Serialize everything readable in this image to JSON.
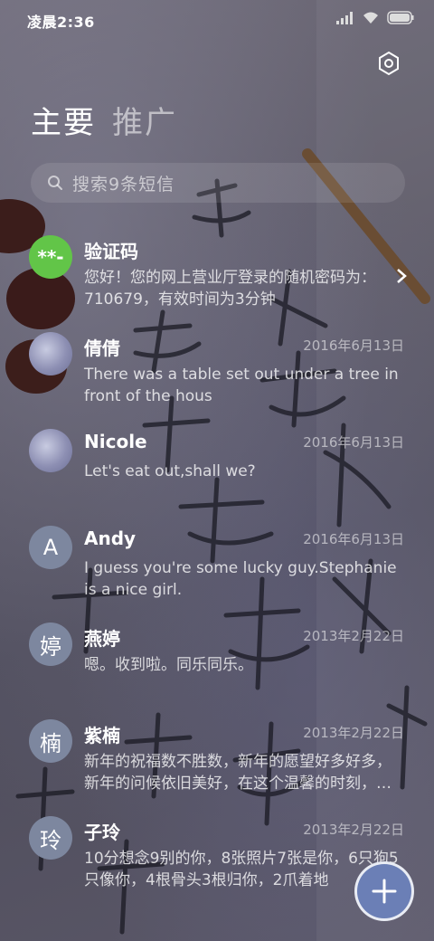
{
  "statusbar": {
    "time": "凌晨2:36"
  },
  "tabs": [
    {
      "label": "主要",
      "active": true
    },
    {
      "label": "推广",
      "active": false
    }
  ],
  "search": {
    "placeholder": "搜索9条短信"
  },
  "conversations": [
    {
      "avatar": "**-",
      "name": "验证码",
      "date": "",
      "preview": "您好！您的网上营业厅登录的随机密码为：710679，有效时间为3分钟"
    },
    {
      "avatar": "",
      "name": "倩倩",
      "date": "2016年6月13日",
      "preview": "There was a table set out under a tree in front of the hous"
    },
    {
      "avatar": "",
      "name": "Nicole",
      "date": "2016年6月13日",
      "preview": "Let's eat out,shall we?"
    },
    {
      "avatar": "A",
      "name": "Andy",
      "date": "2016年6月13日",
      "preview": "I guess you're some lucky guy.Stephanie is a nice girl."
    },
    {
      "avatar": "婷",
      "name": "燕婷",
      "date": "2013年2月22日",
      "preview": "嗯。收到啦。同乐同乐。"
    },
    {
      "avatar": "楠",
      "name": "紫楠",
      "date": "2013年2月22日",
      "preview": "新年的祝福数不胜数，新年的愿望好多好多，新年的问候依旧美好，在这个温馨的时刻，…"
    },
    {
      "avatar": "玲",
      "name": "子玲",
      "date": "2013年2月22日",
      "preview": "10分想念9别的你，8张照片7张是你，6只狗5只像你，4根骨头3根归你，2爪着地"
    }
  ],
  "colors": {
    "accent_green": "#62c548",
    "avatar_blue": "#7d879f",
    "fab": "#6b7fb6"
  },
  "icons": [
    "signal-icon",
    "wifi-icon",
    "battery-icon",
    "settings-icon",
    "search-icon",
    "chevron-right-icon",
    "plus-icon"
  ]
}
